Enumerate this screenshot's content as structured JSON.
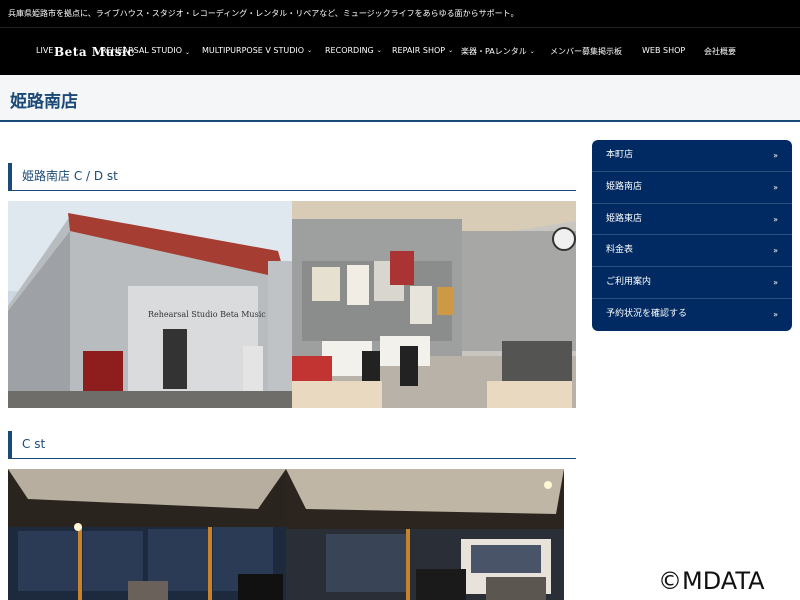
{
  "topbar": {
    "tagline": "兵庫県姫路市を拠点に、ライブハウス・スタジオ・レコーディング・レンタル・リペアなど、ミュージックライフをあらゆる面からサポート。"
  },
  "header": {
    "logo": "Beta Music",
    "nav": [
      {
        "label": "LIVE",
        "has_dropdown": false
      },
      {
        "label": "REHEARSAL STUDIO",
        "has_dropdown": true
      },
      {
        "label": "MULTIPURPOSE V STUDIO",
        "has_dropdown": true
      },
      {
        "label": "RECORDING",
        "has_dropdown": true
      },
      {
        "label": "REPAIR SHOP",
        "has_dropdown": true
      },
      {
        "label": "楽器・PAレンタル",
        "has_dropdown": true
      },
      {
        "label": "メンバー募集掲示板",
        "has_dropdown": false
      },
      {
        "label": "WEB SHOP",
        "has_dropdown": false
      },
      {
        "label": "会社概要",
        "has_dropdown": false
      }
    ]
  },
  "page": {
    "title": "姫路南店"
  },
  "sections": [
    {
      "heading": "姫路南店 C / D st",
      "sign_text": "Rehearsal Studio Beta Music"
    },
    {
      "heading": "C st"
    }
  ],
  "sidebar": {
    "items": [
      {
        "label": "本町店"
      },
      {
        "label": "姫路南店"
      },
      {
        "label": "姫路東店"
      },
      {
        "label": "料金表"
      },
      {
        "label": "ご利用案内"
      },
      {
        "label": "予約状況を確認する"
      }
    ],
    "arrow": "»"
  },
  "watermark": "©MDATA",
  "colors": {
    "brand_navy": "#002a61",
    "heading_blue": "#1b4a78"
  }
}
